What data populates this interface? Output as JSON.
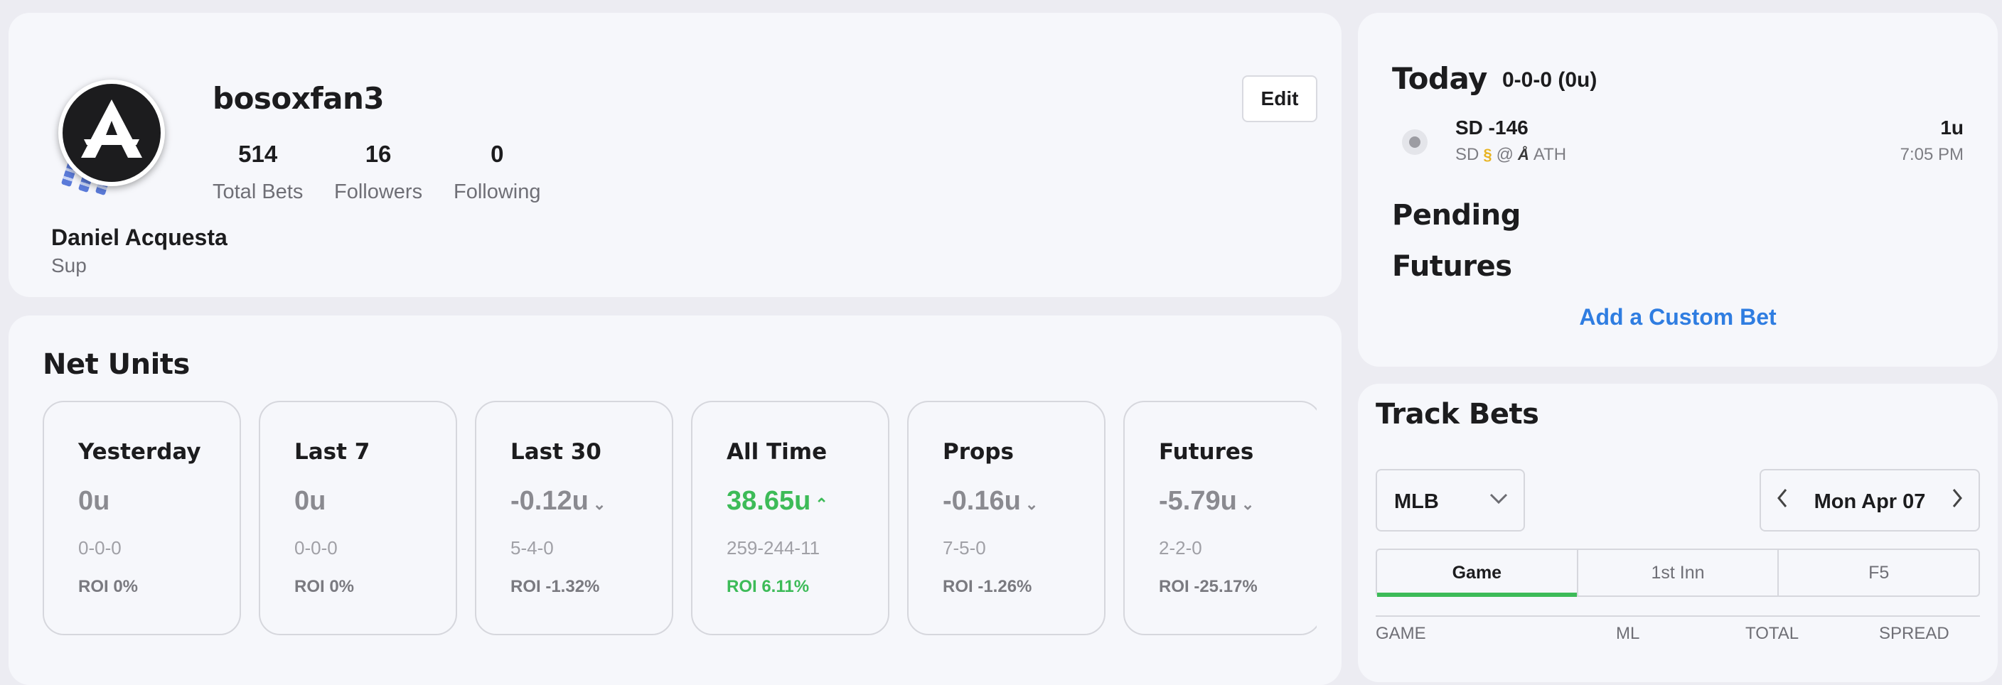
{
  "profile": {
    "username": "bosoxfan3",
    "edit_label": "Edit",
    "avatar_letter": "A",
    "stats": [
      {
        "value": "514",
        "label": "Total Bets"
      },
      {
        "value": "16",
        "label": "Followers"
      },
      {
        "value": "0",
        "label": "Following"
      }
    ],
    "real_name": "Daniel Acquesta",
    "bio": "Sup"
  },
  "net_units": {
    "title": "Net Units",
    "boxes": [
      {
        "title": "Yesterday",
        "units": "0u",
        "trend": "",
        "record": "0-0-0",
        "roi": "ROI 0%",
        "positive": false
      },
      {
        "title": "Last 7",
        "units": "0u",
        "trend": "",
        "record": "0-0-0",
        "roi": "ROI 0%",
        "positive": false
      },
      {
        "title": "Last 30",
        "units": "-0.12u",
        "trend": "⌄",
        "record": "5-4-0",
        "roi": "ROI -1.32%",
        "positive": false
      },
      {
        "title": "All Time",
        "units": "38.65u",
        "trend": "⌃",
        "record": "259-244-11",
        "roi": "ROI 6.11%",
        "positive": true
      },
      {
        "title": "Props",
        "units": "-0.16u",
        "trend": "⌄",
        "record": "7-5-0",
        "roi": "ROI -1.26%",
        "positive": false
      },
      {
        "title": "Futures",
        "units": "-5.79u",
        "trend": "⌄",
        "record": "2-2-0",
        "roi": "ROI -25.17%",
        "positive": false
      }
    ]
  },
  "today": {
    "title": "Today",
    "record": "0-0-0 (0u)",
    "bet": {
      "line": "SD -146",
      "away": "SD",
      "at": "@",
      "home": "ATH",
      "units": "1u",
      "time": "7:05 PM"
    },
    "pending_title": "Pending",
    "futures_title": "Futures",
    "custom_bet_label": "Add a Custom Bet"
  },
  "track": {
    "title": "Track Bets",
    "league": "MLB",
    "date": "Mon Apr 07",
    "tabs": [
      "Game",
      "1st Inn",
      "F5"
    ],
    "columns": [
      "GAME",
      "ML",
      "TOTAL",
      "SPREAD"
    ]
  },
  "colors": {
    "positive": "#3dbb58",
    "link": "#2f7de1",
    "muted": "#8a8a90"
  }
}
